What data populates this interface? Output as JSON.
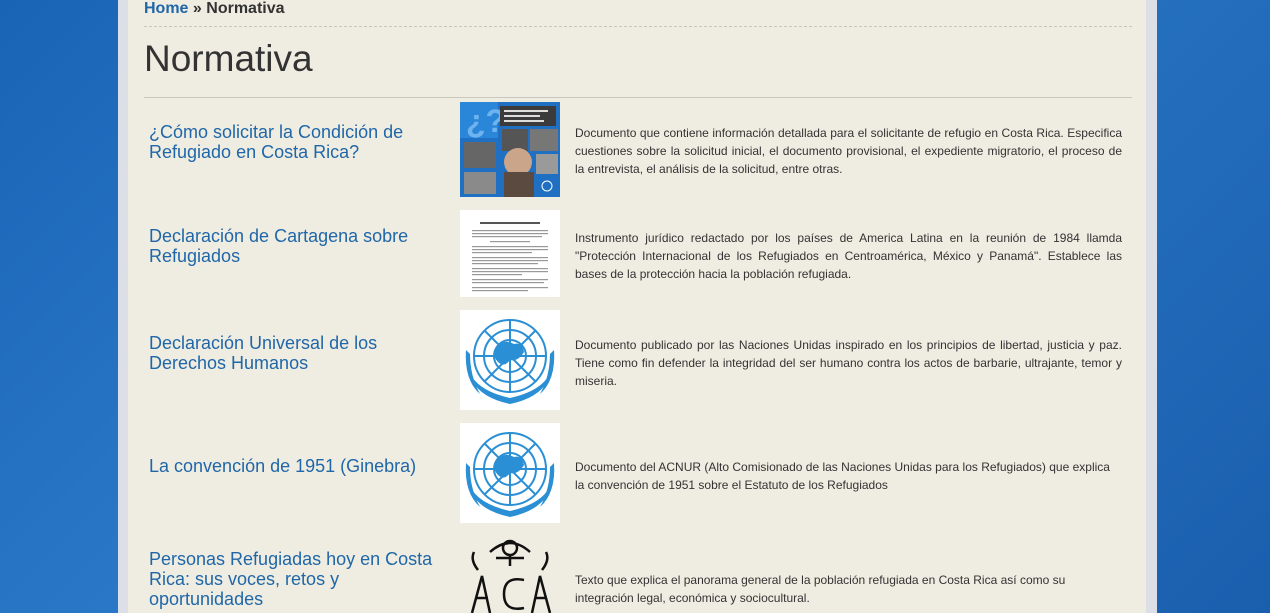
{
  "breadcrumb": {
    "home": "Home",
    "separator": "»",
    "current": "Normativa"
  },
  "page_title": "Normativa",
  "items": [
    {
      "title": "¿Cómo solicitar la Condición de Refugiado en Costa Rica?",
      "thumb": "booklet-cover",
      "description": "Documento que contiene información detallada para el solicitante de refugio en Costa Rica. Especifica cuestiones sobre la solicitud inicial,  el documento provisional, el expediente migratorio, el proceso de la entrevista, el análisis de la solicitud, entre otras."
    },
    {
      "title": "Declaración de Cartagena sobre Refugiados",
      "thumb": "text-document",
      "description": "Instrumento jurídico redactado por los países de America Latina en la reunión de 1984 llamda \"Protección Internacional de los Refugiados en Centroamérica, México y Panamá\". Establece las bases de la protección hacia la población refugiada."
    },
    {
      "title": "Declaración Universal de los Derechos Humanos",
      "thumb": "un-emblem",
      "description": "Documento publicado por las Naciones Unidas inspirado en los principios de libertad, justicia y paz. Tiene como fin defender la integridad del ser humano contra los actos de barbarie, ultrajante, temor y miseria."
    },
    {
      "title": "La convención de 1951 (Ginebra)",
      "thumb": "un-emblem",
      "description": "Documento del ACNUR (Alto Comisionado de las Naciones Unidas para los Refugiados) que explica la convención de 1951 sobre el Estatuto de los Refugiados"
    },
    {
      "title": "Personas Refugiadas hoy en Costa Rica: sus voces, retos y oportunidades",
      "thumb": "aca-logo",
      "description": "Texto que explica el panorama general de la población refugiada en Costa Rica así como su integración legal, económica y sociocultural."
    }
  ],
  "colors": {
    "link": "#1f67a8",
    "page_bg": "#efece1",
    "outer_bg": "#1a64b6",
    "un_blue": "#2a8fd4"
  }
}
